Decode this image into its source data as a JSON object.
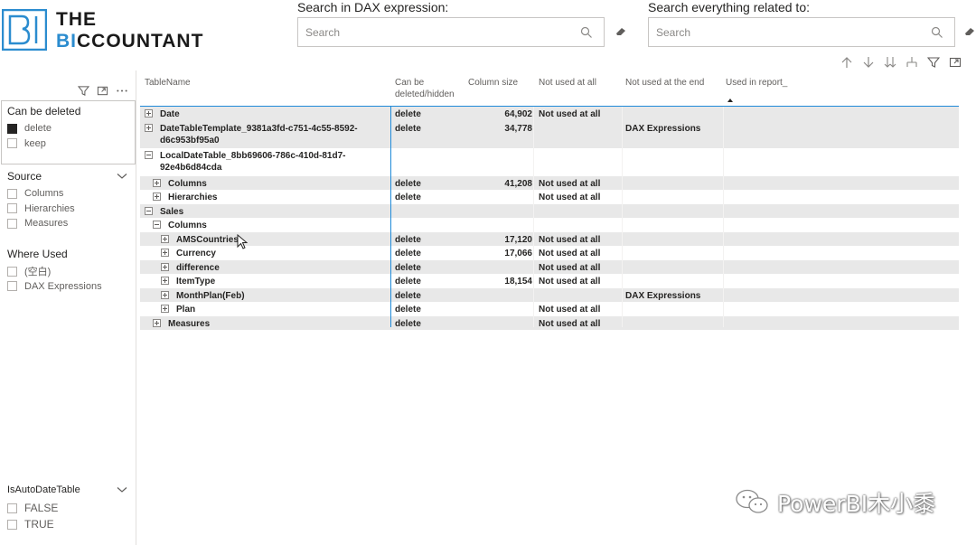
{
  "logo": {
    "line1": "THE",
    "line2_a": "BI",
    "line2_b": "CCOUNTANT"
  },
  "search_dax": {
    "title": "Search in DAX expression:",
    "placeholder": "Search"
  },
  "search_all": {
    "title": "Search everything related to:",
    "placeholder": "Search"
  },
  "toolbar": [
    "arrow-up-icon",
    "arrow-down-icon",
    "double-arrow-down-icon",
    "expand-hierarchy-icon",
    "filter-icon",
    "focus-mode-icon"
  ],
  "slicers": {
    "can_be_deleted": {
      "title": "Can be deleted",
      "items": [
        {
          "label": "delete",
          "checked": true
        },
        {
          "label": "keep",
          "checked": false
        }
      ]
    },
    "source": {
      "title": "Source",
      "items": [
        {
          "label": "Columns"
        },
        {
          "label": "Hierarchies"
        },
        {
          "label": "Measures"
        }
      ]
    },
    "where_used": {
      "title": "Where Used",
      "items": [
        {
          "label": "(空白)"
        },
        {
          "label": "DAX Expressions"
        }
      ]
    },
    "is_auto_date": {
      "title": "IsAutoDateTable",
      "items": [
        {
          "label": "FALSE"
        },
        {
          "label": "TRUE"
        }
      ]
    }
  },
  "table": {
    "headers": {
      "table_name": "TableName",
      "can_be_deleted_1": "Can be",
      "can_be_deleted_2": "deleted/hidden",
      "column_size": "Column size",
      "not_used_all": "Not used at all",
      "not_used_end": "Not used at the end",
      "used_in_report": "Used in report_"
    },
    "rows": [
      {
        "name": "Date",
        "del": "delete",
        "size": "64,902",
        "nua": "Not used at all",
        "end": ""
      },
      {
        "name": "DateTableTemplate_9381a3fd-c751-4c55-8592-d6c953bf95a0",
        "del": "delete",
        "size": "34,778",
        "nua": "",
        "end": "DAX Expressions"
      },
      {
        "name": "LocalDateTable_8bb69606-786c-410d-81d7-92e4b6d84cda",
        "del": "",
        "size": "",
        "nua": "",
        "end": ""
      },
      {
        "name": "Columns",
        "del": "delete",
        "size": "41,208",
        "nua": "Not used at all",
        "end": ""
      },
      {
        "name": "Hierarchies",
        "del": "delete",
        "size": "",
        "nua": "Not used at all",
        "end": ""
      },
      {
        "name": "Sales",
        "del": "",
        "size": "",
        "nua": "",
        "end": ""
      },
      {
        "name": "Columns",
        "del": "",
        "size": "",
        "nua": "",
        "end": ""
      },
      {
        "name": "AMSCountries",
        "del": "delete",
        "size": "17,120",
        "nua": "Not used at all",
        "end": ""
      },
      {
        "name": "Currency",
        "del": "delete",
        "size": "17,066",
        "nua": "Not used at all",
        "end": ""
      },
      {
        "name": "difference",
        "del": "delete",
        "size": "",
        "nua": "Not used at all",
        "end": ""
      },
      {
        "name": "ItemType",
        "del": "delete",
        "size": "18,154",
        "nua": "Not used at all",
        "end": ""
      },
      {
        "name": "MonthPlan(Feb)",
        "del": "delete",
        "size": "",
        "nua": "",
        "end": "DAX Expressions"
      },
      {
        "name": "Plan",
        "del": "delete",
        "size": "",
        "nua": "Not used at all",
        "end": ""
      },
      {
        "name": "Measures",
        "del": "delete",
        "size": "",
        "nua": "Not used at all",
        "end": ""
      }
    ]
  },
  "watermark": "PowerBI木小黍"
}
